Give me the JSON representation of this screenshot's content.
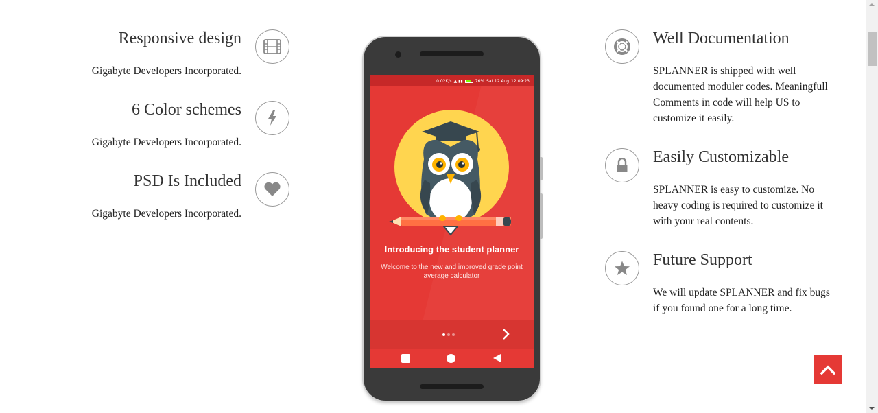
{
  "left_features": [
    {
      "title": "Responsive design",
      "text": "Gigabyte Developers Incorporated.",
      "icon": "film-icon"
    },
    {
      "title": "6 Color schemes",
      "text": "Gigabyte Developers Incorporated.",
      "icon": "bolt-icon"
    },
    {
      "title": "PSD Is Included",
      "text": "Gigabyte Developers Incorporated.",
      "icon": "heart-icon"
    }
  ],
  "right_features": [
    {
      "title": "Well Documentation",
      "text": "SPLANNER is shipped with well documented moduler codes. Meaningfull Comments in code will help US to customize it easily.",
      "icon": "life-ring-icon"
    },
    {
      "title": "Easily Customizable",
      "text": "SPLANNER is easy to customize. No heavy coding is required to customize it with your real contents.",
      "icon": "lock-icon"
    },
    {
      "title": "Future Support",
      "text": "We will update SPLANNER and fix bugs if you found one for a long time.",
      "icon": "star-icon"
    }
  ],
  "phone": {
    "status": {
      "speed": "0.02K/s",
      "battery": "76%",
      "date": "Sat 12 Aug",
      "time": "12:09:23"
    },
    "screen_title": "Introducing the student planner",
    "screen_text": "Welcome to the new and improved grade point average calculator",
    "pager": {
      "pages": 3,
      "active_page": 1
    }
  },
  "colors": {
    "accent": "#e53935",
    "owl_circle": "#ffd54f",
    "icon_gray": "#888888"
  }
}
